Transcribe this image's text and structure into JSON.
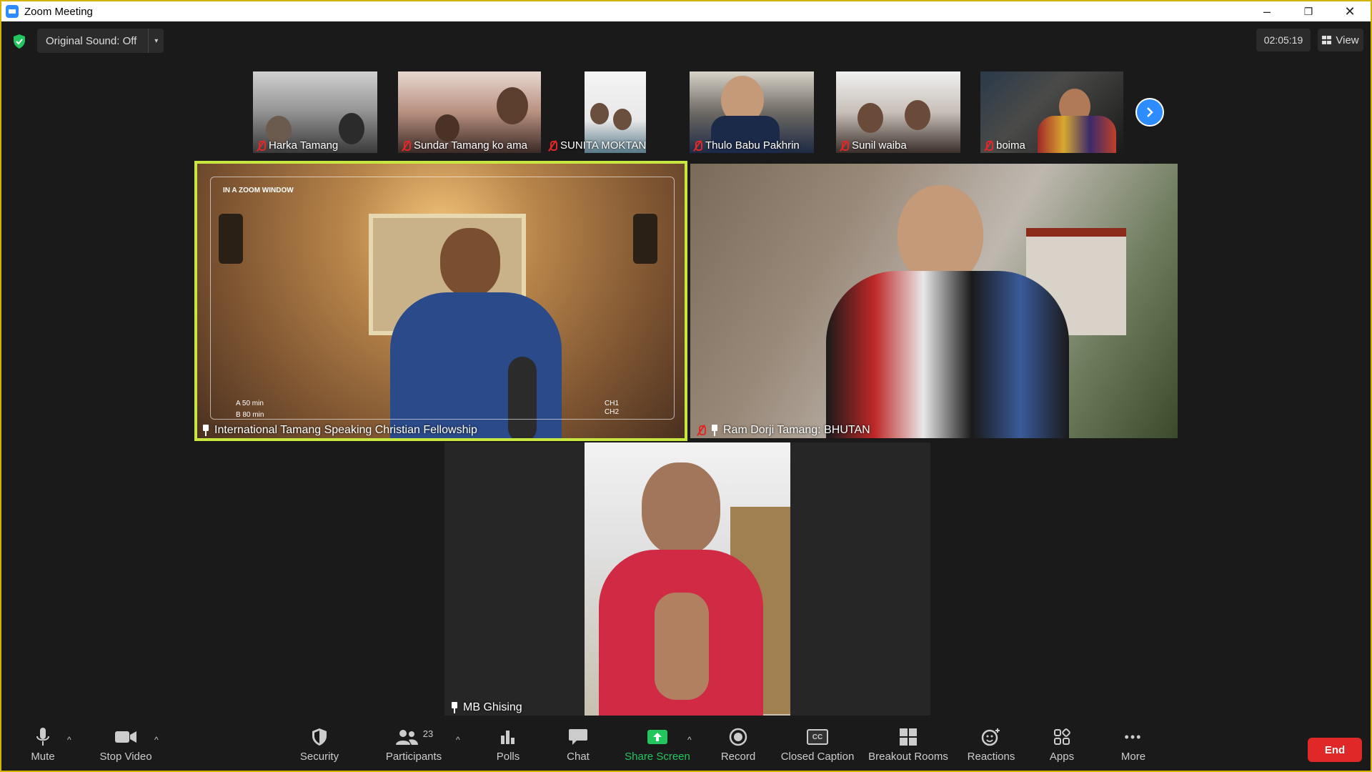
{
  "window": {
    "title": "Zoom Meeting",
    "minimize": "–",
    "restore": "❐",
    "close": "✕"
  },
  "header": {
    "original_sound": "Original Sound: Off",
    "caret": "▾",
    "timer": "02:05:19",
    "view": "View"
  },
  "thumbnails": [
    {
      "name": "Harka Tamang",
      "muted": true
    },
    {
      "name": "Sundar Tamang ko ama",
      "muted": true
    },
    {
      "name": "SUNITA  MOKTAN",
      "muted": true
    },
    {
      "name": "Thulo Babu Pakhrin",
      "muted": true
    },
    {
      "name": "Sunil waiba",
      "muted": true
    },
    {
      "name": "boima",
      "muted": true
    }
  ],
  "tiles": {
    "main_left": {
      "name": "International Tamang Speaking Christian Fellowship",
      "overlay_top": "IN A ZOOM WINDOW",
      "overlay_a": "A  50 min",
      "overlay_b": "B  80 min",
      "ch1": "CH1",
      "ch2": "CH2"
    },
    "main_right": {
      "name": "Ram Dorji Tamang: BHUTAN"
    },
    "bottom": {
      "name": "MB Ghising"
    }
  },
  "toolbar": {
    "mute": "Mute",
    "stop_video": "Stop Video",
    "security": "Security",
    "participants": "Participants",
    "participants_count": "23",
    "polls": "Polls",
    "chat": "Chat",
    "share_screen": "Share Screen",
    "record": "Record",
    "closed_caption": "Closed Caption",
    "breakout_rooms": "Breakout Rooms",
    "reactions": "Reactions",
    "apps": "Apps",
    "more": "More",
    "end": "End",
    "caret": "^",
    "cc_text": "CC",
    "more_dots": "•••"
  },
  "colors": {
    "accent": "#2d8cff",
    "end": "#e02828",
    "share": "#22c55e",
    "active_border": "#c8e640",
    "window_border": "#d4b400"
  }
}
